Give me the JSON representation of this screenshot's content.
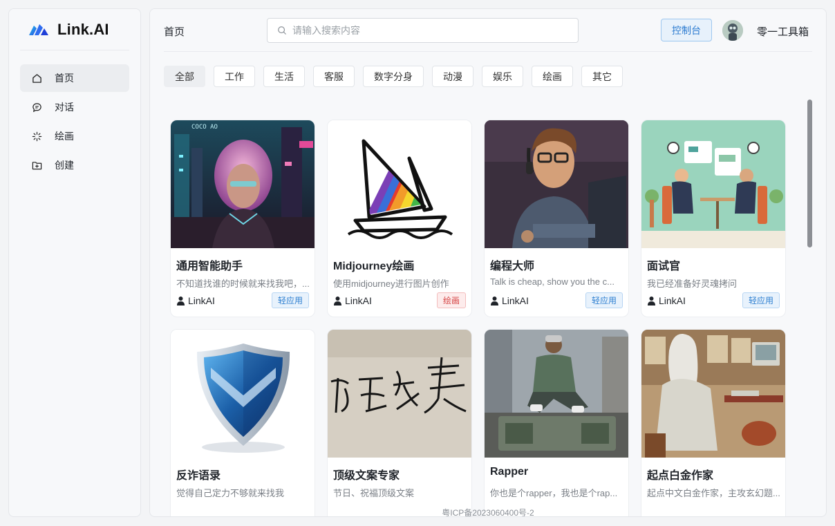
{
  "brand": {
    "name": "Link.AI"
  },
  "sidebar": {
    "items": [
      {
        "label": "首页",
        "icon": "home-icon",
        "active": true
      },
      {
        "label": "对话",
        "icon": "chat-icon",
        "active": false
      },
      {
        "label": "绘画",
        "icon": "sparkle-icon",
        "active": false
      },
      {
        "label": "创建",
        "icon": "folder-plus-icon",
        "active": false
      }
    ]
  },
  "header": {
    "title": "首页",
    "search_placeholder": "请输入搜索内容",
    "console_label": "控制台",
    "username": "零一工具箱"
  },
  "tabs": [
    {
      "label": "全部",
      "active": true
    },
    {
      "label": "工作",
      "active": false
    },
    {
      "label": "生活",
      "active": false
    },
    {
      "label": "客服",
      "active": false
    },
    {
      "label": "数字分身",
      "active": false
    },
    {
      "label": "动漫",
      "active": false
    },
    {
      "label": "娱乐",
      "active": false
    },
    {
      "label": "绘画",
      "active": false
    },
    {
      "label": "其它",
      "active": false
    }
  ],
  "cards": [
    {
      "title": "通用智能助手",
      "desc": "不知道找谁的时候就来找我吧，...",
      "author": "LinkAI",
      "badge": "轻应用",
      "badge_color": "blue",
      "image": "cyberpunk-woman-illustration"
    },
    {
      "title": "Midjourney绘画",
      "desc": "使用midjourney进行图片创作",
      "author": "LinkAI",
      "badge": "绘画",
      "badge_color": "red",
      "image": "midjourney-sailboat-logo"
    },
    {
      "title": "编程大师",
      "desc": "Talk is cheap, show you the c...",
      "author": "LinkAI",
      "badge": "轻应用",
      "badge_color": "blue",
      "image": "programmer-with-headphones-illustration"
    },
    {
      "title": "面试官",
      "desc": "我已经准备好灵魂拷问",
      "author": "LinkAI",
      "badge": "轻应用",
      "badge_color": "blue",
      "image": "job-interview-illustration"
    },
    {
      "title": "反诈语录",
      "desc": "觉得自己定力不够就来找我",
      "image": "security-shield-image"
    },
    {
      "title": "顶级文案专家",
      "desc": "节日、祝福顶级文案",
      "image": "calligraphy-paper-image"
    },
    {
      "title": "Rapper",
      "desc": "你也是个rapper，我也是个rap...",
      "image": "rapper-sitting-illustration"
    },
    {
      "title": "起点白金作家",
      "desc": "起点中文白金作家，主攻玄幻题...",
      "image": "old-writer-at-computer-illustration"
    }
  ],
  "footer": {
    "icp": "粤ICP备2023060400号-2"
  }
}
